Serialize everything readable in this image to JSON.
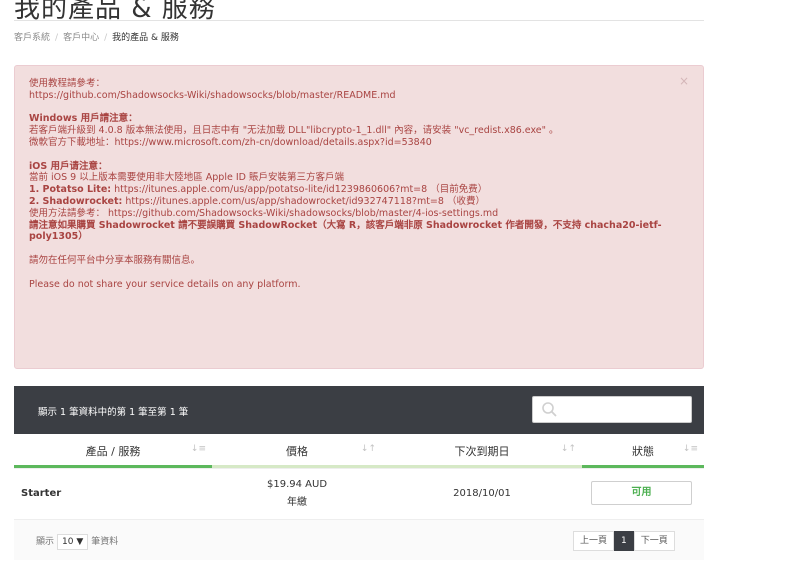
{
  "page": {
    "title": "我的產品 & 服務",
    "breadcrumb": [
      "客戶系統",
      "客戶中心",
      "我的產品 & 服務"
    ],
    "separator": "/"
  },
  "alert": {
    "close": "×",
    "lines": [
      {
        "text": "使用教程請參考：",
        "bold": false
      },
      {
        "text": "https://github.com/Shadowsocks-Wiki/shadowsocks/blob/master/README.md",
        "bold": false
      },
      {
        "text": "",
        "bold": false
      },
      {
        "text": "Windows 用戶請注意：",
        "bold": true
      },
      {
        "text": "若客戶端升級到 4.0.8 版本無法使用，且日志中有 \"无法加载 DLL\"libcrypto-1_1.dll\" 內容，请安装 \"vc_redist.x86.exe\" 。",
        "bold": false
      },
      {
        "text": "微軟官方下載地址：https://www.microsoft.com/zh-cn/download/details.aspx?id=53840",
        "bold": false
      },
      {
        "text": "",
        "bold": false
      },
      {
        "text": "iOS 用戶请注意：",
        "bold": true
      },
      {
        "text": "當前 iOS 9 以上版本需要使用非大陸地區 Apple ID 賬戶安裝第三方客戶端",
        "bold": false
      },
      {
        "text": "1. Potatso Lite: https://itunes.apple.com/us/app/potatso-lite/id1239860606?mt=8 （目前免费）",
        "bold": false,
        "prefix_bold": "1. Potatso Lite:"
      },
      {
        "text": "2. Shadowrocket: https://itunes.apple.com/us/app/shadowrocket/id932747118?mt=8 （收費）",
        "bold": false,
        "prefix_bold": "2. Shadowrocket:"
      },
      {
        "text": "使用方法請參考： https://github.com/Shadowsocks-Wiki/shadowsocks/blob/master/4-ios-settings.md",
        "bold": false
      },
      {
        "text": "請注意如果購買 Shadowrocket 請不要誤購買 ShadowRocket（大寫 R，該客戶端非原 Shadowrocket 作者開發，不支持 chacha20-ietf-poly1305）",
        "bold": true
      },
      {
        "text": "",
        "bold": false
      },
      {
        "text": "請勿在任何平台中分享本服務有關信息。",
        "bold": false
      },
      {
        "text": "",
        "bold": false
      },
      {
        "text": "Please do not share your service details on any platform.",
        "bold": false
      }
    ]
  },
  "table": {
    "info": "顯示 1 筆資料中的第 1 筆至第 1 筆",
    "search_placeholder": "",
    "columns": [
      {
        "label": "產品 / 服務",
        "sort": "↓≡",
        "bar_color": "#5cb85c"
      },
      {
        "label": "價格",
        "sort": "↓↑",
        "bar_color": "#d6e9c6"
      },
      {
        "label": "下次到期日",
        "sort": "↓↑",
        "bar_color": "#d6e9c6"
      },
      {
        "label": "狀態",
        "sort": "↓≡",
        "bar_color": "#5cb85c"
      }
    ],
    "rows": [
      {
        "product": "Starter",
        "price": "$19.94 AUD",
        "cycle": "年繳",
        "due": "2018/10/01",
        "status": "可用"
      }
    ],
    "footer": {
      "show_prefix": "顯示",
      "length": "10",
      "length_arrow": "▼",
      "show_suffix": "筆資料",
      "prev": "上一頁",
      "page": "1",
      "next": "下一頁"
    }
  },
  "colors": {
    "alert_bg": "#f2dede",
    "alert_text": "#a94442",
    "table_header_bg": "#3b3e44",
    "status_green": "#4caf50"
  }
}
